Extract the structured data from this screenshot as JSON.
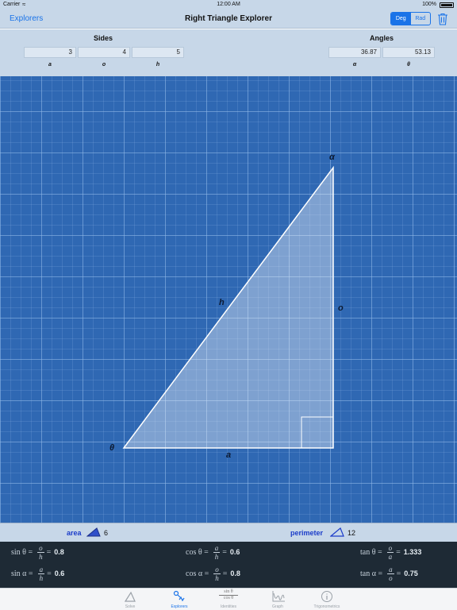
{
  "status_bar": {
    "carrier": "Carrier",
    "time": "12:00 AM",
    "battery": "100%"
  },
  "nav": {
    "back_label": "Explorers",
    "title": "Right Triangle Explorer",
    "deg_label": "Deg",
    "rad_label": "Rad",
    "unit_selected": "Deg"
  },
  "sides": {
    "title": "Sides",
    "a": {
      "label": "a",
      "value": "3"
    },
    "o": {
      "label": "o",
      "value": "4"
    },
    "h": {
      "label": "h",
      "value": "5"
    }
  },
  "angles": {
    "title": "Angles",
    "alpha": {
      "label": "α",
      "value": "36.87"
    },
    "theta": {
      "label": "θ",
      "value": "53.13"
    }
  },
  "diagram": {
    "vertex_alpha": "α",
    "vertex_theta": "θ",
    "side_a": "a",
    "side_o": "o",
    "side_h": "h"
  },
  "area": {
    "label": "area",
    "value": "6"
  },
  "perimeter": {
    "label": "perimeter",
    "value": "12"
  },
  "trig": {
    "sin_theta": {
      "fn": "sin θ =",
      "num": "o",
      "den": "h",
      "value": "0.8"
    },
    "cos_theta": {
      "fn": "cos θ =",
      "num": "a",
      "den": "h",
      "value": "0.6"
    },
    "tan_theta": {
      "fn": "tan θ =",
      "num": "o",
      "den": "a",
      "value": "1.333"
    },
    "sin_alpha": {
      "fn": "sin α =",
      "num": "a",
      "den": "h",
      "value": "0.6"
    },
    "cos_alpha": {
      "fn": "cos α =",
      "num": "o",
      "den": "h",
      "value": "0.8"
    },
    "tan_alpha": {
      "fn": "tan α =",
      "num": "a",
      "den": "o",
      "value": "0.75"
    }
  },
  "tabs": [
    {
      "label": "Solve",
      "icon": "triangle-icon"
    },
    {
      "label": "Explorers",
      "icon": "explorers-icon",
      "active": true
    },
    {
      "label": "Identities",
      "icon": "identities-icon",
      "icon_text_top": "sin θ",
      "icon_text_bottom": "cos θ"
    },
    {
      "label": "Graph",
      "icon": "graph-icon"
    },
    {
      "label": "Trigonometrics",
      "icon": "info-icon"
    }
  ],
  "colors": {
    "accent": "#1a73e8",
    "blueprint": "#2f68b3",
    "trig_panel": "#1e2a35",
    "strip_label": "#1b3cc9"
  }
}
